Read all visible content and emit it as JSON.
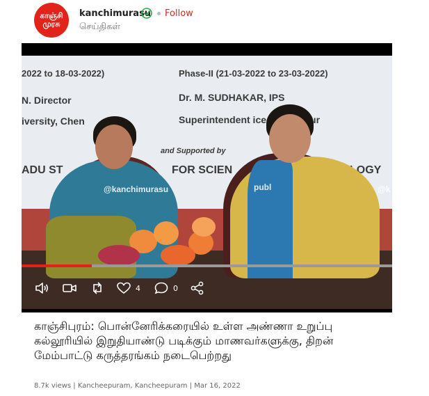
{
  "header": {
    "avatar_line1": "காஞ்சி",
    "avatar_line2": "முரசு",
    "channel_name": "kanchimurasu",
    "follow_label": "Follow",
    "category": "செய்திகள்"
  },
  "video": {
    "banner_left_date": "2022 to 18-03-2022)",
    "banner_left_name": "N. Director",
    "banner_left_univ": "iversity, Chen",
    "banner_phase": "Phase-II (21-03-2022 to 23-03-2022)",
    "banner_speaker": "Dr. M. SUDHAKAR, IPS",
    "banner_role": "Superintendent    ice, Kanchipur",
    "banner_supported": "and Supported by",
    "banner_bottom_left": "ADU ST",
    "banner_bottom_mid": "FOR SCIEN",
    "banner_bottom_right": "LOGY",
    "watermark_1": "@kanchimurasu",
    "watermark_2": "publ",
    "watermark_3": "@k",
    "progress": 0.19,
    "like_count": "4",
    "comment_count": "0"
  },
  "post": {
    "headline": "காஞ்சிபுரம்: பொன்னேரிக்கரையில் உள்ள அண்ணா உறுப்பு கல்லூரியில் இறுதியாண்டு படிக்கும் மாணவர்களுக்கு, திறன் மேம்பாட்டு கருத்தரங்கம் நடைபெற்றது",
    "meta": "8.7k views | Kancheepuram, Kancheepuram | Mar 16, 2022"
  },
  "colors": {
    "brand_red": "#e2231a",
    "verified_green": "#2fa64a"
  },
  "icons": {
    "verified": "verified-check-icon",
    "volume": "volume-icon",
    "video": "video-camera-icon",
    "repost": "repost-icon",
    "like": "heart-icon",
    "comment": "comment-icon",
    "share": "share-icon"
  }
}
